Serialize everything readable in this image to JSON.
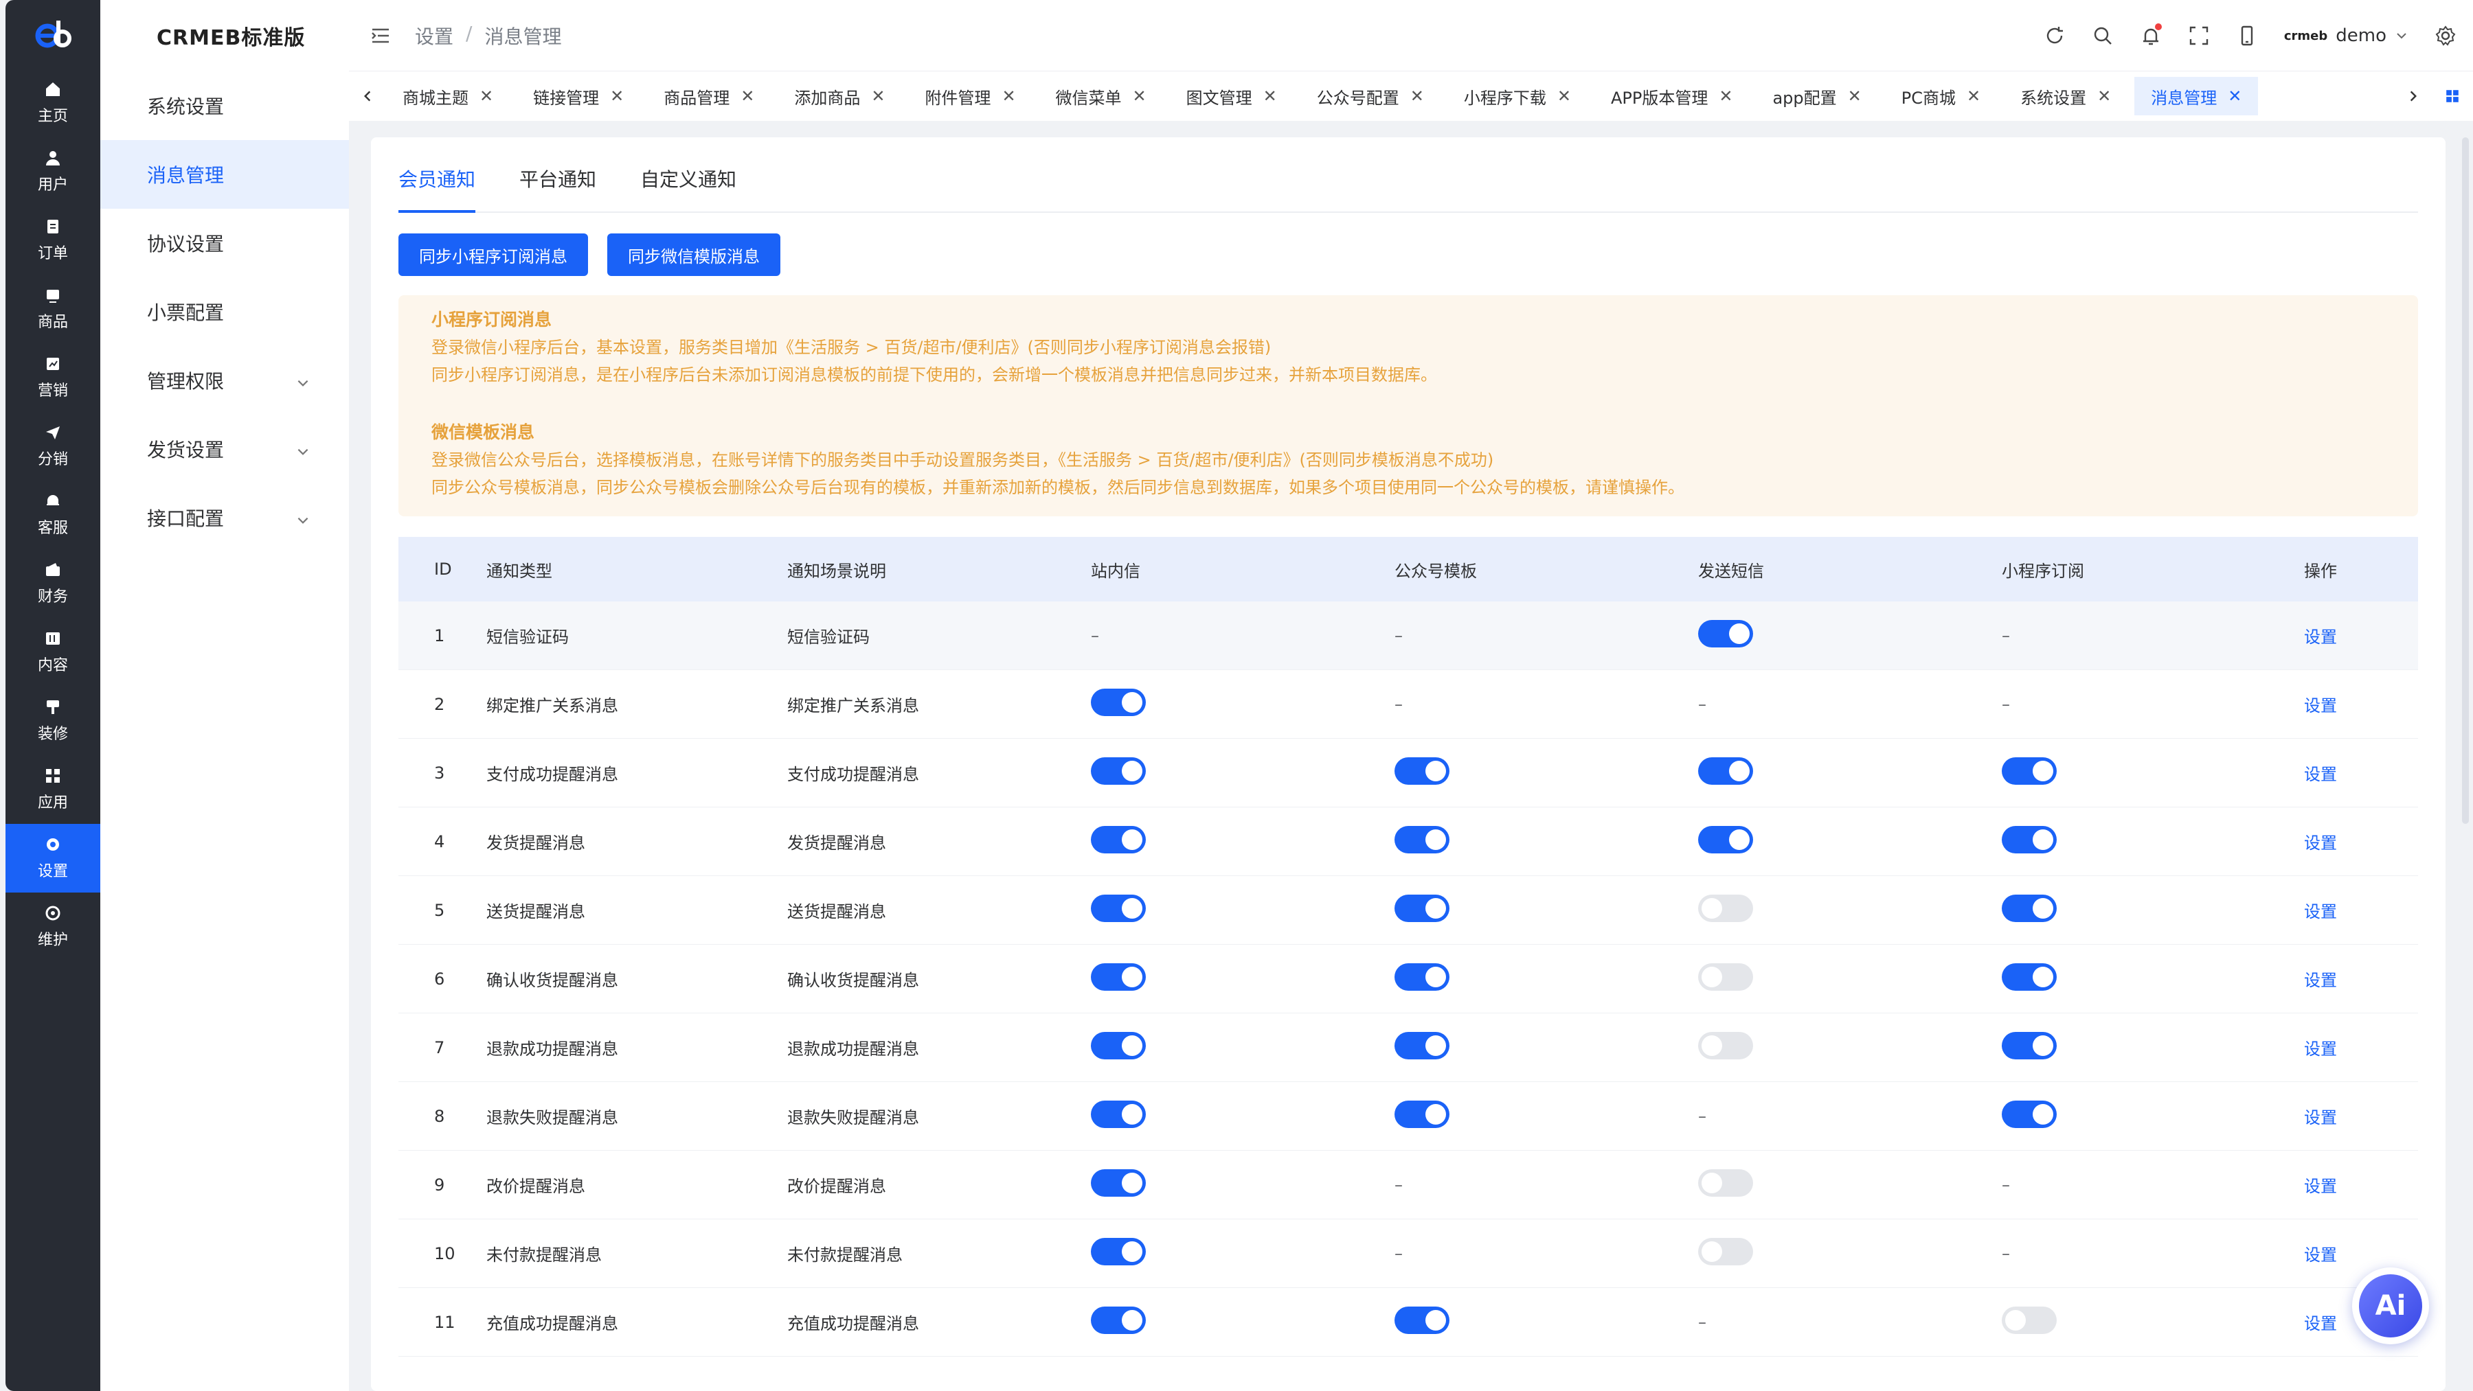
{
  "rail": {
    "items": [
      {
        "label": "主页",
        "icon": "home-icon"
      },
      {
        "label": "用户",
        "icon": "user-icon"
      },
      {
        "label": "订单",
        "icon": "order-icon"
      },
      {
        "label": "商品",
        "icon": "product-icon"
      },
      {
        "label": "营销",
        "icon": "marketing-icon"
      },
      {
        "label": "分销",
        "icon": "distribution-icon"
      },
      {
        "label": "客服",
        "icon": "service-icon"
      },
      {
        "label": "财务",
        "icon": "finance-icon"
      },
      {
        "label": "内容",
        "icon": "content-icon"
      },
      {
        "label": "装修",
        "icon": "decorate-icon"
      },
      {
        "label": "应用",
        "icon": "apps-icon"
      },
      {
        "label": "设置",
        "icon": "gear-icon"
      },
      {
        "label": "维护",
        "icon": "maintain-icon"
      }
    ],
    "active_index": 11
  },
  "sidebar": {
    "brand": "CRMEB标准版",
    "items": [
      {
        "label": "系统设置",
        "has_children": false
      },
      {
        "label": "消息管理",
        "has_children": false
      },
      {
        "label": "协议设置",
        "has_children": false
      },
      {
        "label": "小票配置",
        "has_children": false
      },
      {
        "label": "管理权限",
        "has_children": true
      },
      {
        "label": "发货设置",
        "has_children": true
      },
      {
        "label": "接口配置",
        "has_children": true
      }
    ],
    "active_index": 1
  },
  "header": {
    "breadcrumb": [
      "设置",
      "消息管理"
    ],
    "breadcrumb_sep": "/",
    "user_logo_text": "crmeb",
    "user_name": "demo"
  },
  "tabs": {
    "items": [
      "商城主题",
      "链接管理",
      "商品管理",
      "添加商品",
      "附件管理",
      "微信菜单",
      "图文管理",
      "公众号配置",
      "小程序下载",
      "APP版本管理",
      "app配置",
      "PC商城",
      "系统设置",
      "消息管理"
    ],
    "active_index": 13,
    "close_glyph": "✕"
  },
  "content": {
    "subtabs": [
      "会员通知",
      "平台通知",
      "自定义通知"
    ],
    "active_subtab": 0,
    "buttons": [
      "同步小程序订阅消息",
      "同步微信模版消息"
    ],
    "notice": {
      "mini_title": "小程序订阅消息",
      "mini_line1": "登录微信小程序后台，基本设置，服务类目增加《生活服务 > 百货/超市/便利店》(否则同步小程序订阅消息会报错)",
      "mini_line2": "同步小程序订阅消息，是在小程序后台未添加订阅消息模板的前提下使用的，会新增一个模板消息并把信息同步过来，并新本项目数据库。",
      "wx_title": "微信模板消息",
      "wx_line1": "登录微信公众号后台，选择模板消息，在账号详情下的服务类目中手动设置服务类目，《生活服务 > 百货/超市/便利店》(否则同步模板消息不成功)",
      "wx_line2": "同步公众号模板消息，同步公众号模板会删除公众号后台现有的模板，并重新添加新的模板，然后同步信息到数据库，如果多个项目使用同一个公众号的模板，请谨慎操作。"
    },
    "table": {
      "columns": [
        "ID",
        "通知类型",
        "通知场景说明",
        "站内信",
        "公众号模板",
        "发送短信",
        "小程序订阅",
        "操作"
      ],
      "dash": "–",
      "op_label": "设置",
      "rows": [
        {
          "id": "1",
          "type": "短信验证码",
          "desc": "短信验证码",
          "site": null,
          "mp": null,
          "sms": true,
          "mini": null
        },
        {
          "id": "2",
          "type": "绑定推广关系消息",
          "desc": "绑定推广关系消息",
          "site": true,
          "mp": null,
          "sms": null,
          "mini": null
        },
        {
          "id": "3",
          "type": "支付成功提醒消息",
          "desc": "支付成功提醒消息",
          "site": true,
          "mp": true,
          "sms": true,
          "mini": true
        },
        {
          "id": "4",
          "type": "发货提醒消息",
          "desc": "发货提醒消息",
          "site": true,
          "mp": true,
          "sms": true,
          "mini": true
        },
        {
          "id": "5",
          "type": "送货提醒消息",
          "desc": "送货提醒消息",
          "site": true,
          "mp": true,
          "sms": false,
          "mini": true
        },
        {
          "id": "6",
          "type": "确认收货提醒消息",
          "desc": "确认收货提醒消息",
          "site": true,
          "mp": true,
          "sms": false,
          "mini": true
        },
        {
          "id": "7",
          "type": "退款成功提醒消息",
          "desc": "退款成功提醒消息",
          "site": true,
          "mp": true,
          "sms": false,
          "mini": true
        },
        {
          "id": "8",
          "type": "退款失败提醒消息",
          "desc": "退款失败提醒消息",
          "site": true,
          "mp": true,
          "sms": null,
          "mini": true
        },
        {
          "id": "9",
          "type": "改价提醒消息",
          "desc": "改价提醒消息",
          "site": true,
          "mp": null,
          "sms": false,
          "mini": null
        },
        {
          "id": "10",
          "type": "未付款提醒消息",
          "desc": "未付款提醒消息",
          "site": true,
          "mp": null,
          "sms": false,
          "mini": null
        },
        {
          "id": "11",
          "type": "充值成功提醒消息",
          "desc": "充值成功提醒消息",
          "site": true,
          "mp": true,
          "sms": null,
          "mini": false
        }
      ]
    }
  },
  "ai_button": {
    "label": "Ai"
  },
  "colors": {
    "primary": "#1a62f7",
    "rail_bg": "#282c34",
    "notice_text": "#e6a23c",
    "notice_bg": "#fdf6ec"
  }
}
